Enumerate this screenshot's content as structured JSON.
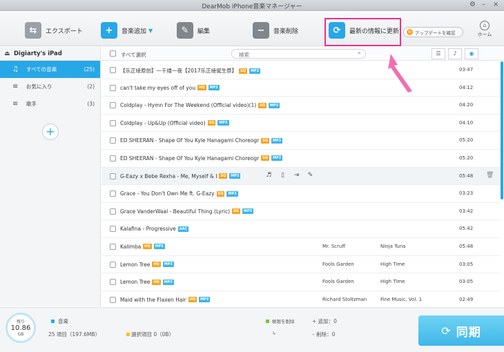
{
  "window": {
    "title": "DearMob iPhone音楽マネージャー"
  },
  "toolbar": {
    "export": "エクスポート",
    "add_music": "音楽追加",
    "edit": "編集",
    "delete_music": "音楽削除",
    "refresh": "最新の情報に更新",
    "update_check": "アップデートを確認",
    "home": "ホーム"
  },
  "sidebar": {
    "device": "Digiarty's iPad",
    "items": [
      {
        "label": "すべての音楽",
        "count": "(25)"
      },
      {
        "label": "お気に入り",
        "count": "(2)"
      },
      {
        "label": "歌手",
        "count": "(3)"
      }
    ]
  },
  "list": {
    "select_all": "すべて選択",
    "search_placeholder": "検索",
    "rows": [
      {
        "title": "【乐正绫原创】一千缕一夜【2017乐正绫诞生祭】",
        "badges": [
          "SQ",
          "MP3"
        ],
        "artist": "",
        "album": "",
        "duration": "03:47"
      },
      {
        "title": "can't take my eyes off of you",
        "badges": [
          "HQ",
          "MP3"
        ],
        "artist": "",
        "album": "",
        "duration": "04:12"
      },
      {
        "title": "Coldplay - Hymn For The Weekend (Official video)(1)",
        "badges": [
          "SQ",
          "MP3"
        ],
        "artist": "",
        "album": "",
        "duration": "04:20"
      },
      {
        "title": "Coldplay - Up&Up (Official video)",
        "badges": [
          "SQ",
          "MP3"
        ],
        "artist": "",
        "album": "",
        "duration": "04:10"
      },
      {
        "title": "ED SHEERAN - Shape Of You   Kyle Hanagami Choreogr",
        "badges": [
          "SQ",
          "MP3"
        ],
        "artist": "",
        "album": "",
        "duration": "05:20"
      },
      {
        "title": "ED SHEERAN - Shape Of You   Kyle Hanagami Choreogr",
        "badges": [
          "SQ",
          "MP3"
        ],
        "artist": "",
        "album": "",
        "duration": "05:20"
      },
      {
        "title": "G-Eazy x Bebe Rexha - Me, Myself & I",
        "badges": [
          "SQ",
          "MP3"
        ],
        "artist": "",
        "album": "",
        "duration": "05:48"
      },
      {
        "title": "Grace - You Don't Own Me ft. G-Eazy",
        "badges": [
          "SQ",
          "MP3"
        ],
        "artist": "",
        "album": "",
        "duration": "03:23"
      },
      {
        "title": "Grace VanderWaal - Beautiful Thing (Lyric)",
        "badges": [
          "SQ",
          "MP3"
        ],
        "artist": "",
        "album": "",
        "duration": "03:42"
      },
      {
        "title": "Kalafina - Progressive",
        "badges": [
          "AAC"
        ],
        "artist": "",
        "album": "",
        "duration": "05:42"
      },
      {
        "title": "Kalimba",
        "badges": [
          "HQ",
          "MP3"
        ],
        "artist": "Mr. Scruff",
        "album": "Ninja Tuna",
        "duration": "05:48"
      },
      {
        "title": "Lemon Tree",
        "badges": [
          "HQ",
          "MP3"
        ],
        "artist": "Fools Garden",
        "album": "High Time",
        "duration": "03:05"
      },
      {
        "title": "Lemon Tree",
        "badges": [
          "HQ",
          "MP3"
        ],
        "artist": "Fools Garden",
        "album": "High Time",
        "duration": "03:05"
      },
      {
        "title": "Maid with the Flaxen Hair",
        "badges": [
          "HQ",
          "MP3"
        ],
        "artist": "Richard Stoltzman",
        "album": "Fine Music, Vol. 1",
        "duration": "02:49"
      }
    ]
  },
  "bottom": {
    "storage_label": "残り",
    "storage_value": "10.86",
    "storage_unit": "GB",
    "music_label": "音楽",
    "summary": "25 項目（197.6MB）",
    "selected": "選択項目 0（0B）",
    "perm_delete": "極限を削除",
    "add_count": "+ 追加：0",
    "del_count": "– 削除：0",
    "sync": "同期"
  },
  "colors": {
    "accent": "#28a7e6",
    "highlight": "#ec2d8b",
    "badge_orange": "#f6a21e"
  }
}
